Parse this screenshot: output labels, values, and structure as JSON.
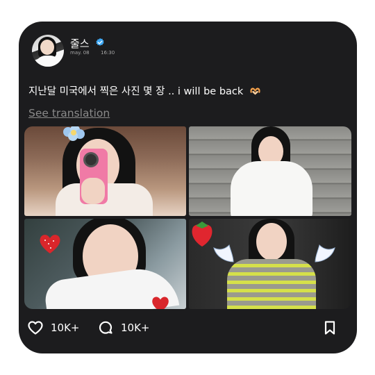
{
  "post": {
    "username": "줄스",
    "verified": true,
    "date": "may. 08",
    "time": "16:30",
    "caption": "지난달 미국에서 찍은 사진 몇 장 .. i will be back",
    "caption_emoji": "heart-hands-emoji",
    "see_translation": "See translation",
    "photos": [
      {
        "alt_name": "photo-mirror-selfie"
      },
      {
        "alt_name": "photo-stairs-white-dress"
      },
      {
        "alt_name": "photo-closeup-selfie"
      },
      {
        "alt_name": "photo-striped-sweater"
      }
    ],
    "likes": "10K+",
    "comments": "10K+",
    "icons": {
      "verified": "verified-badge-icon",
      "like": "heart-icon",
      "comment": "comment-bubble-icon",
      "save": "bookmark-icon"
    }
  },
  "colors": {
    "card_bg": "#1c1c1e",
    "verified_blue": "#3fa9f5",
    "text_primary": "#ffffff",
    "text_secondary": "#8a8a8a"
  }
}
